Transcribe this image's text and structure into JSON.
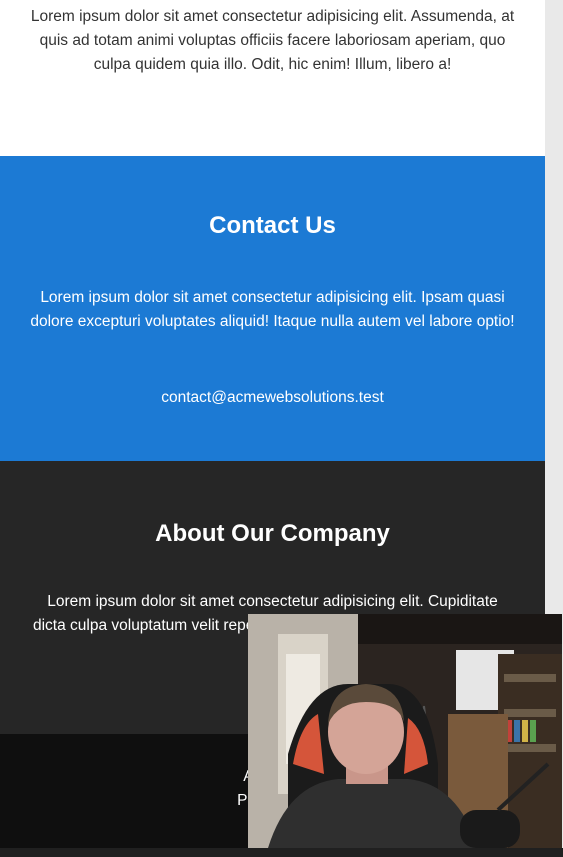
{
  "intro": {
    "text": "Lorem ipsum dolor sit amet consectetur adipisicing elit. Assumenda, at quis ad totam animi voluptas officiis facere laboriosam aperiam, quo culpa quidem quia illo. Odit, hic enim! Illum, libero a!"
  },
  "contact": {
    "title": "Contact Us",
    "text": "Lorem ipsum dolor sit amet consectetur adipisicing elit. Ipsam quasi dolore excepturi voluptates aliquid! Itaque nulla autem vel labore optio!",
    "email": "contact@acmewebsolutions.test"
  },
  "about": {
    "title": "About Our Company",
    "text": "Lorem ipsum dolor sit amet consectetur adipisicing elit. Cupiditate dicta culpa voluptatum velit repellendus aperiam tenetur, Natus tempo"
  },
  "footer": {
    "line1": "Acme W",
    "line2": "Project By"
  },
  "colors": {
    "contact_bg": "#1c7ad4",
    "about_bg": "#262626",
    "footer_bg": "#0f0f0f"
  }
}
